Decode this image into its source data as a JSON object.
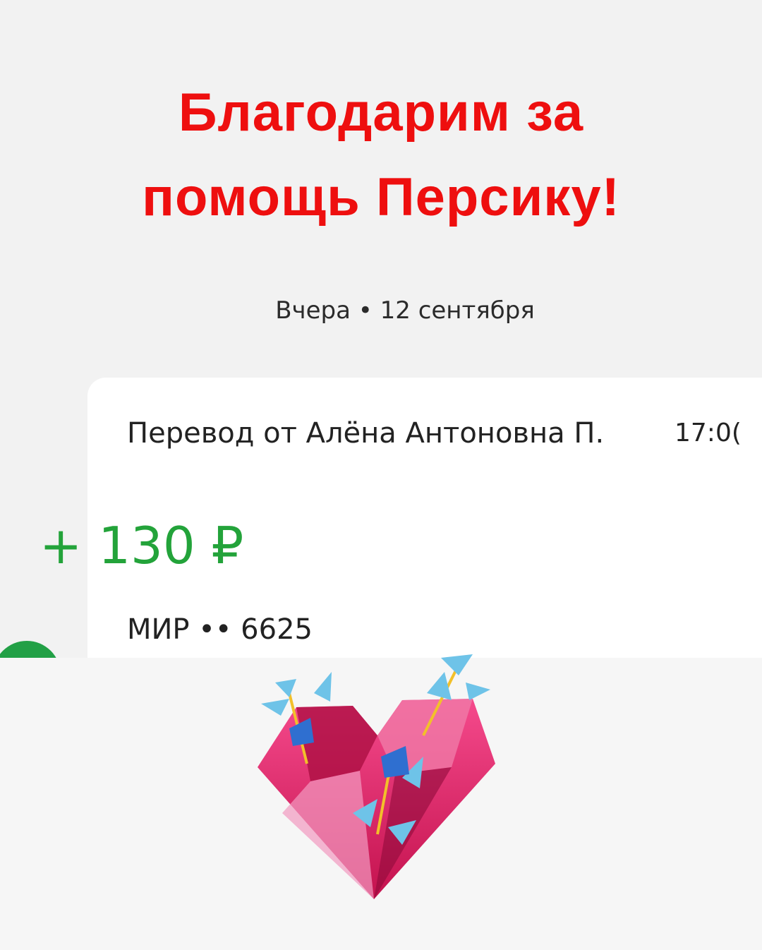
{
  "headline": {
    "line1": "Благодарим за",
    "line2": "помощь Персику!"
  },
  "date_header": "Вчера • 12 сентября",
  "transaction": {
    "title": "Перевод от Алёна Антоновна П.",
    "time": "17:0(",
    "amount": "+ 130 ₽",
    "card": "МИР •• 6625"
  },
  "colors": {
    "headline": "#ee0f0f",
    "amount": "#23a33a",
    "avatar": "#22a046",
    "heart": "#e0306f"
  },
  "illustration": "heart-with-flowers"
}
